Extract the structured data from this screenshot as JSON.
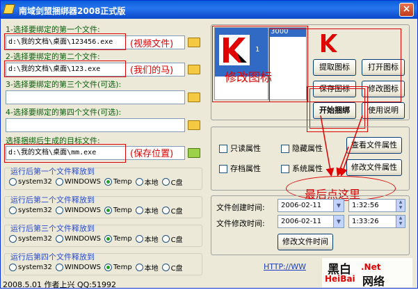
{
  "window": {
    "title": "南域剑盟捆绑器2008正式版",
    "close": "×"
  },
  "left": {
    "f1": {
      "label": "1-选择要绑定的第一个文件:",
      "value": "d:\\我的文档\\桌面\\123456.exe",
      "note": "(视频文件)"
    },
    "f2": {
      "label": "2-选择要绑定的第二个文件:",
      "value": "d:\\我的文档\\桌面\\123.exe",
      "note": "(我们的马)"
    },
    "f3": {
      "label": "3-选择要绑定的第三个文件(可选):",
      "value": ""
    },
    "f4": {
      "label": "4-选择要绑定的第四个文件(可选):",
      "value": ""
    },
    "target": {
      "label": "选择捆绑后生成的目标文件:",
      "value": "d:\\我的文档\\桌面\\mm.exe",
      "note": "(保存位置)"
    },
    "release": [
      {
        "label": "运行后第一个文件释放到",
        "selected": 2
      },
      {
        "label": "运行后第二个文件释放到",
        "selected": 2
      },
      {
        "label": "运行后第三个文件释放到",
        "selected": 2
      },
      {
        "label": "运行后第四个文件释放到",
        "selected": 2
      }
    ],
    "options": [
      "system32",
      "WINDOWS",
      "Temp",
      "本地",
      "C盘"
    ]
  },
  "right": {
    "icon_index": "1",
    "list_value": "3000",
    "note": "修改图标",
    "buttons": {
      "extract": "提取图标",
      "open": "打开图标",
      "save": "保存图标",
      "modify": "修改图标",
      "start": "开始捆绑",
      "help": "使用说明",
      "view_attr": "查看文件属性",
      "modify_attr": "修改文件属性",
      "modify_time": "修改文件时间"
    },
    "attrs": {
      "readonly": "只读属性",
      "hidden": "隐藏属性",
      "archive": "存档属性",
      "system": "系统属性"
    },
    "final_note": "最后点这里",
    "created": {
      "label": "文件创建时间:",
      "date": "2006-02-11",
      "time": "1:32:56"
    },
    "modified": {
      "label": "文件修改时间:",
      "date": "2006-02-11",
      "time": "1:33:26"
    },
    "url": "HTTP://WW"
  },
  "status": {
    "text": "2008.5.01   作者上兴   QQ:51992"
  },
  "watermark": {
    "cn1": "黑白",
    "net": ".Net",
    "cn2": "网络",
    "en": "HeiBai"
  },
  "colors": {
    "accent": "#e00000",
    "label": "#0a5e0a",
    "title": "#0a5fd8"
  }
}
